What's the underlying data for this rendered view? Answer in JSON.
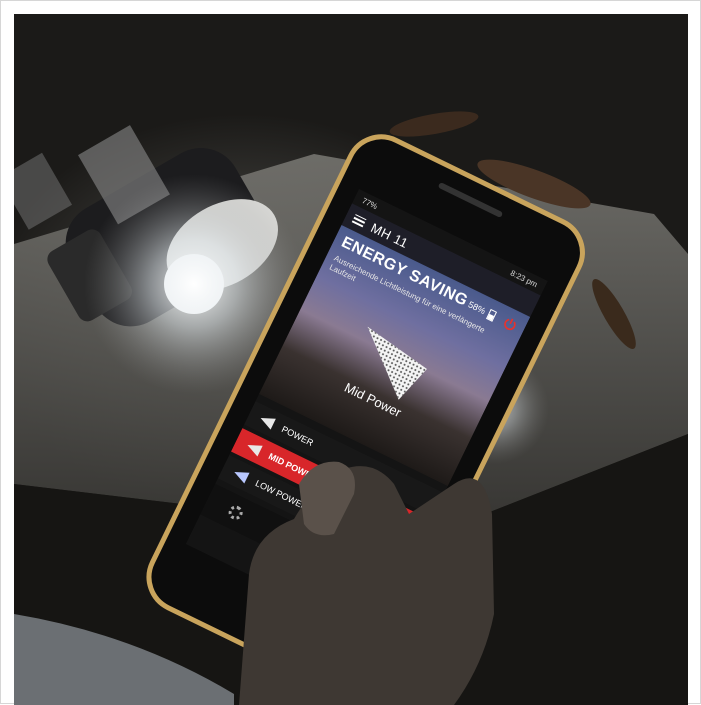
{
  "status": {
    "time": "8:23 pm",
    "signal": "77%"
  },
  "app": {
    "title": "MH 11"
  },
  "mode": {
    "title": "ENERGY SAVING",
    "battery": "58%",
    "description": "Ausreichende Lichtleistung für eine verlängerte Laufzeit",
    "beam_label": "Mid Power"
  },
  "modes": [
    {
      "label": "POWER",
      "active": false
    },
    {
      "label": "MID POWER",
      "active": true
    },
    {
      "label": "LOW POWER",
      "active": false
    }
  ],
  "colors": {
    "accent": "#d8262a",
    "frame_gold": "#c9a45c"
  },
  "icons": {
    "menu": "hamburger-icon",
    "power": "power-icon",
    "settings": "gear-icon",
    "stop": "stop-icon",
    "dial": "dial-icon"
  }
}
